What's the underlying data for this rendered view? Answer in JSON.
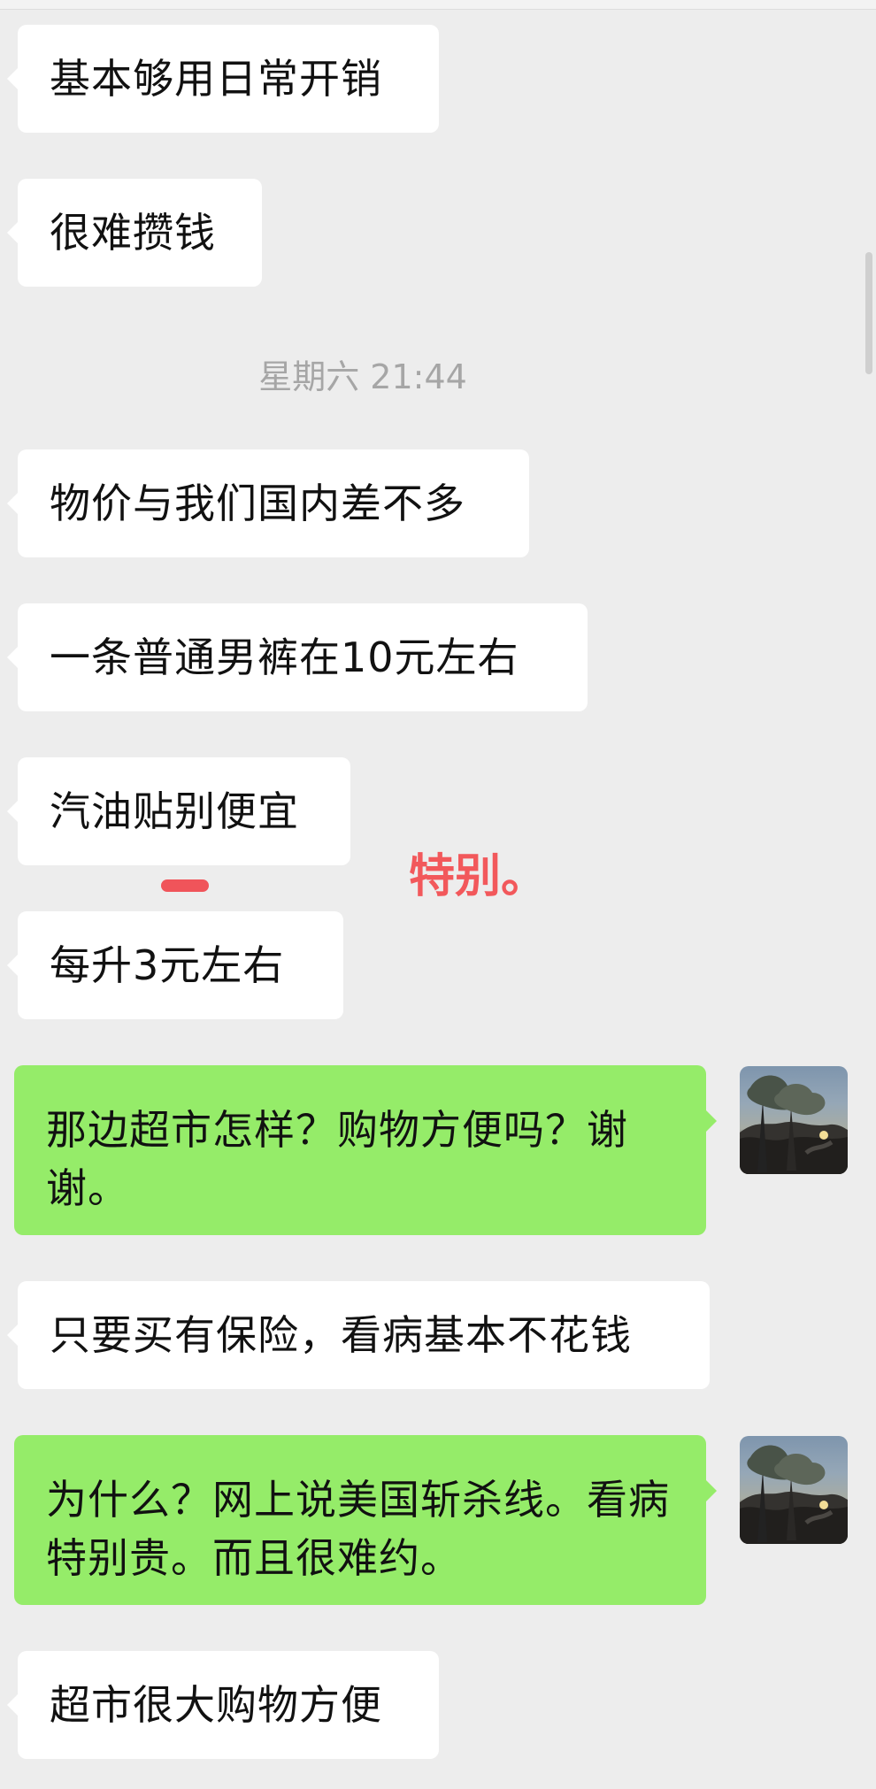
{
  "messages": [
    {
      "text": "基本够用日常开销"
    },
    {
      "text": "很难攒钱"
    },
    {
      "text": "物价与我们国内差不多"
    },
    {
      "text": "一条普通男裤在10元左右"
    },
    {
      "text": "汽油贴别便宜"
    },
    {
      "text": "每升3元左右"
    },
    {
      "text": "那边超市怎样？购物方便吗？谢谢。"
    },
    {
      "text": "只要买有保险，看病基本不花钱"
    },
    {
      "text": "为什么？网上说美国斩杀线。看病特别贵。而且很难约。"
    },
    {
      "text": "超市很大购物方便"
    }
  ],
  "timestamp": "星期六 21:44",
  "annotation": "特别。",
  "colors": {
    "background": "#ededed",
    "incoming_bubble": "#ffffff",
    "outgoing_bubble": "#95ec69",
    "timestamp_text": "#a6a6a6",
    "annotation": "#f2585b"
  },
  "icons": {
    "avatar": "tree-landscape-avatar"
  }
}
